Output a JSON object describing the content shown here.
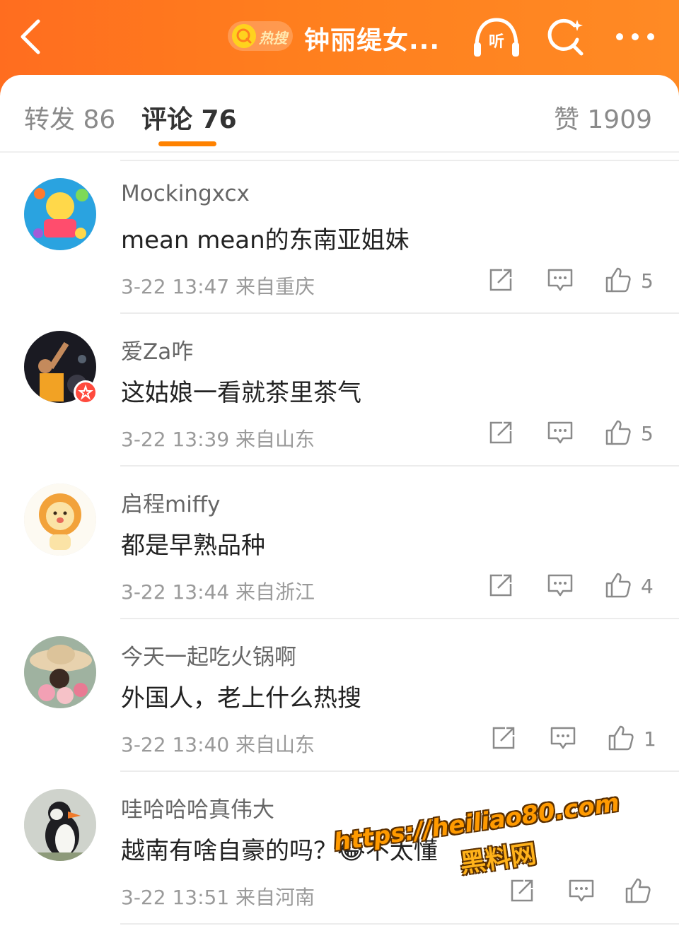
{
  "header": {
    "hot_label": "热搜",
    "topic_title": "钟丽缇女...",
    "listen_label": "听"
  },
  "tabs": {
    "repost": "转发 86",
    "comment": "评论 76",
    "like": "赞 1909"
  },
  "comments": [
    {
      "username": "Mockingxcx",
      "content": "mean mean的东南亚姐妹",
      "meta": "3-22 13:47 来自重庆",
      "likes": "5"
    },
    {
      "username": "爱Za咋",
      "content": "这姑娘一看就茶里茶气",
      "meta": "3-22 13:39 来自山东",
      "likes": "5"
    },
    {
      "username": "启程miffy",
      "content": "都是早熟品种",
      "meta": "3-22 13:44 来自浙江",
      "likes": "4"
    },
    {
      "username": "今天一起吃火锅啊",
      "content": "外国人，老上什么热搜",
      "meta": "3-22 13:40 来自山东",
      "likes": "1"
    },
    {
      "username": "哇哈哈哈真伟大",
      "content": "越南有啥自豪的吗？😂不太懂",
      "meta": "3-22 13:51 来自河南",
      "likes": ""
    }
  ],
  "watermark": {
    "url": "https://heiliao80.com",
    "name": "黑料网"
  },
  "colors": {
    "header": "#ff7f1e",
    "accent": "#ff8200",
    "badge": "#ff4a3d"
  }
}
